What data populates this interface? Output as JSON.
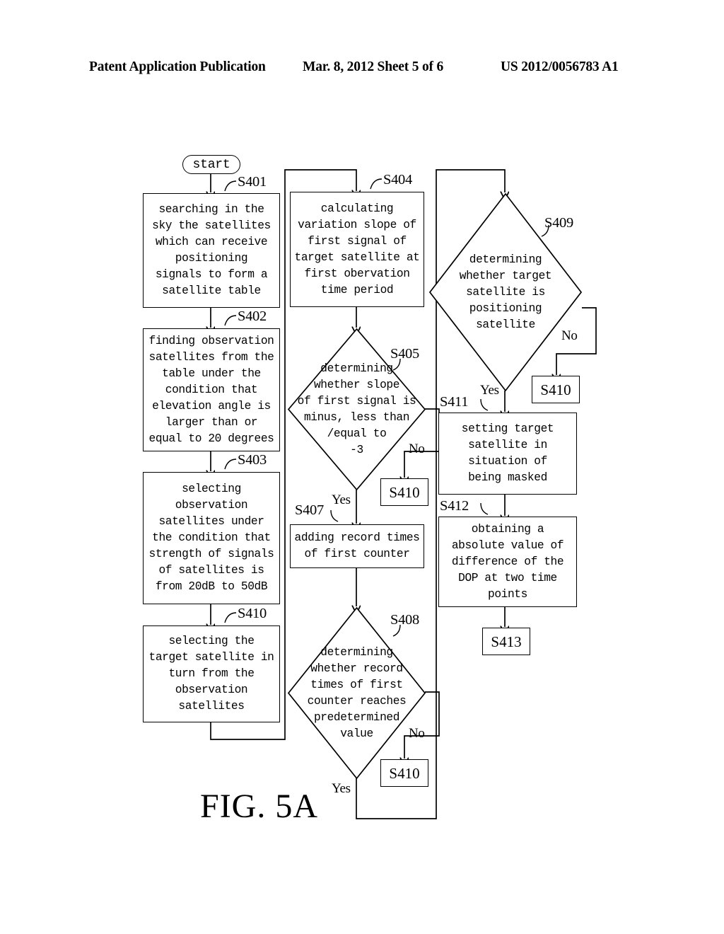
{
  "header": {
    "left": "Patent Application Publication",
    "middle": "Mar. 8, 2012   Sheet 5 of 6",
    "right": "US 2012/0056783 A1"
  },
  "figure": {
    "caption": "FIG. 5A"
  },
  "flowchart": {
    "start": {
      "label": "start"
    },
    "nodes": {
      "s401": {
        "ref": "S401",
        "text": "searching in the\nsky the satellites\nwhich can receive\npositioning\nsignals to form a\nsatellite table"
      },
      "s402": {
        "ref": "S402",
        "text": "finding observation\nsatellites from the\ntable under the\ncondition that\nelevation angle is\nlarger than or\nequal to 20 degrees"
      },
      "s403": {
        "ref": "S403",
        "text": "selecting\nobservation\nsatellites under\nthe condition that\nstrength of signals\nof satellites is\nfrom 20dB to 50dB"
      },
      "s410_left": {
        "ref": "S410",
        "text": "selecting the\ntarget satellite in\nturn from the\nobservation\nsatellites"
      },
      "s404": {
        "ref": "S404",
        "text": "calculating\nvariation slope of\nfirst signal of\ntarget satellite at\nfirst obervation\ntime period"
      },
      "s405": {
        "ref": "S405",
        "text": "determining\nwhether slope\nof first signal is\nminus, less than\n/equal to\n-3"
      },
      "s405_no_box": {
        "text": "S410"
      },
      "s407": {
        "ref": "S407",
        "text": "adding record times\nof first counter"
      },
      "s408": {
        "ref": "S408",
        "text": "determining\nwhether record\ntimes of first\ncounter reaches\npredetermined\nvalue"
      },
      "s408_no_box": {
        "text": "S410"
      },
      "s409": {
        "ref": "S409",
        "text": "determining\nwhether target\nsatellite is\npositioning\nsatellite"
      },
      "s409_no_box": {
        "text": "S410"
      },
      "s411": {
        "ref": "S411",
        "text": "setting target\nsatellite in\nsituation of\nbeing masked"
      },
      "s412": {
        "ref": "S412",
        "text": "obtaining a\nabsolute value of\ndifference of the\nDOP at two time\npoints"
      },
      "s413": {
        "text": "S413"
      }
    },
    "edge_labels": {
      "s405_yes": "Yes",
      "s405_no": "No",
      "s408_yes": "Yes",
      "s408_no": "No",
      "s409_yes": "Yes",
      "s409_no": "No"
    }
  }
}
